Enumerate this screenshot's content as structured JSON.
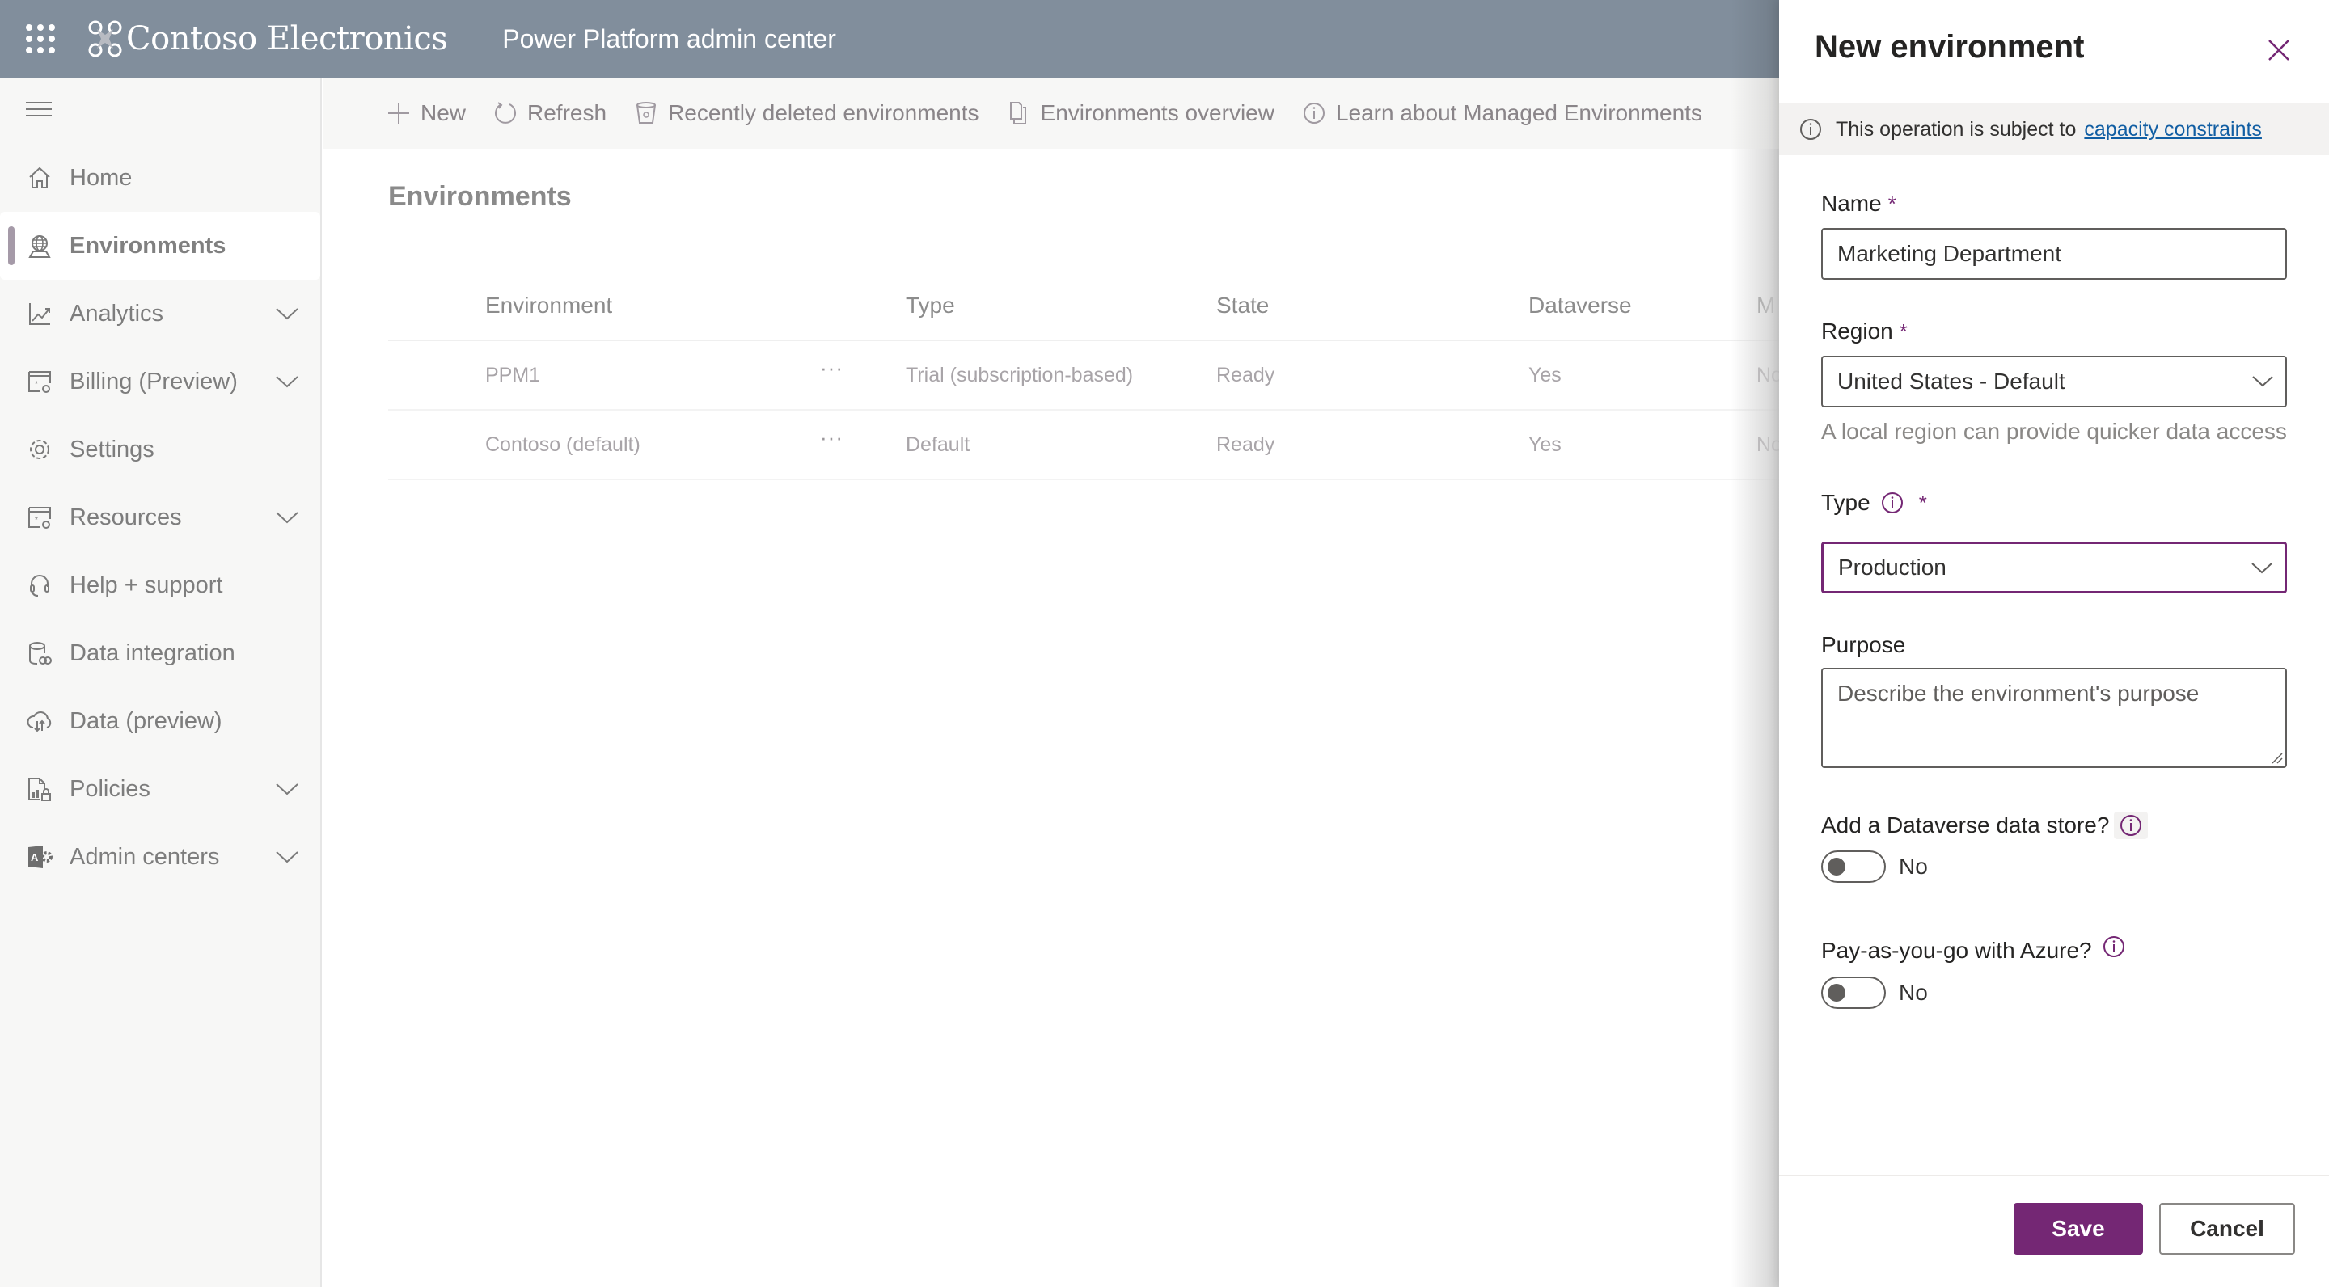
{
  "header": {
    "app_launcher_icon": "waffle-icon",
    "brand_logo_icon": "drone-logo-icon",
    "brand_name": "Contoso Electronics",
    "app_title": "Power Platform admin center"
  },
  "sidebar": {
    "menu_icon": "hamburger-icon",
    "items": [
      {
        "label": "Home",
        "icon": "home-icon",
        "expandable": false,
        "active": false
      },
      {
        "label": "Environments",
        "icon": "globe-icon",
        "expandable": false,
        "active": true
      },
      {
        "label": "Analytics",
        "icon": "chart-line-icon",
        "expandable": true,
        "active": false
      },
      {
        "label": "Billing (Preview)",
        "icon": "billing-settings-icon",
        "expandable": true,
        "active": false
      },
      {
        "label": "Settings",
        "icon": "gear-icon",
        "expandable": false,
        "active": false
      },
      {
        "label": "Resources",
        "icon": "resources-icon",
        "expandable": true,
        "active": false
      },
      {
        "label": "Help + support",
        "icon": "headset-icon",
        "expandable": false,
        "active": false
      },
      {
        "label": "Data integration",
        "icon": "database-link-icon",
        "expandable": false,
        "active": false
      },
      {
        "label": "Data (preview)",
        "icon": "cloud-sync-icon",
        "expandable": false,
        "active": false
      },
      {
        "label": "Policies",
        "icon": "policy-lock-icon",
        "expandable": true,
        "active": false
      },
      {
        "label": "Admin centers",
        "icon": "admin-center-icon",
        "expandable": true,
        "active": false
      }
    ]
  },
  "commandbar": {
    "items": [
      {
        "label": "New",
        "icon": "plus-icon"
      },
      {
        "label": "Refresh",
        "icon": "refresh-icon"
      },
      {
        "label": "Recently deleted environments",
        "icon": "recycle-bin-icon"
      },
      {
        "label": "Environments overview",
        "icon": "copy-pages-icon"
      },
      {
        "label": "Learn about Managed Environments",
        "icon": "info-icon"
      }
    ]
  },
  "main": {
    "title": "Environments",
    "table": {
      "columns": [
        "Environment",
        "Type",
        "State",
        "Dataverse",
        "M"
      ],
      "more_label": "···",
      "rows": [
        {
          "environment": "PPM1",
          "type": "Trial (subscription-based)",
          "state": "Ready",
          "dataverse": "Yes",
          "managed": "No"
        },
        {
          "environment": "Contoso (default)",
          "type": "Default",
          "state": "Ready",
          "dataverse": "Yes",
          "managed": "No"
        }
      ]
    }
  },
  "panel": {
    "title": "New environment",
    "close_icon": "close-icon",
    "notice": {
      "text": "This operation is subject to",
      "link": "capacity constraints"
    },
    "name": {
      "label": "Name",
      "required": "*",
      "value": "Marketing Department"
    },
    "region": {
      "label": "Region",
      "required": "*",
      "value": "United States - Default",
      "hint": "A local region can provide quicker data access"
    },
    "type": {
      "label": "Type",
      "required": "*",
      "value": "Production"
    },
    "purpose": {
      "label": "Purpose",
      "placeholder": "Describe the environment's purpose",
      "value": ""
    },
    "dataverse": {
      "label": "Add a Dataverse data store?",
      "state": "No",
      "on": false
    },
    "payg": {
      "label": "Pay-as-you-go with Azure?",
      "state": "No",
      "on": false
    },
    "buttons": {
      "save": "Save",
      "cancel": "Cancel"
    },
    "accent_color": "#742774"
  }
}
